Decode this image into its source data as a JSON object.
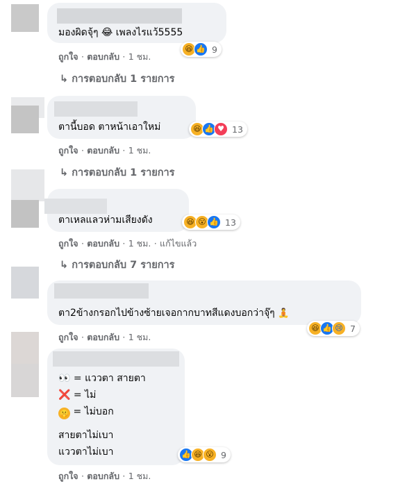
{
  "comments": [
    {
      "text": "มองผิดจุ้ๆ 😂 เพลงไรแว้5555",
      "reaction_count": "9",
      "actions": {
        "like": "ถูกใจ",
        "reply": "ตอบกลับ",
        "time": "1 ชม."
      },
      "replies": "การตอบกลับ 1 รายการ"
    },
    {
      "text": "ตานี้บอด ตาหน้าเอาใหม่",
      "reaction_count": "13",
      "actions": {
        "like": "ถูกใจ",
        "reply": "ตอบกลับ",
        "time": "1 ชม."
      },
      "replies": "การตอบกลับ 1 รายการ"
    },
    {
      "text": "ตาเหลแลวห่ามเสียงดัง",
      "reaction_count": "13",
      "actions": {
        "like": "ถูกใจ",
        "reply": "ตอบกลับ",
        "time": "1 ชม.",
        "edited": "แก้ไขแล้ว"
      },
      "replies": "การตอบกลับ 7 รายการ"
    },
    {
      "text": "ตา2ข้างกรอกไปข้างซ้ายเจอกากบาทสีแดงบอกว่าจุ๊ๆ",
      "reaction_count": "7",
      "actions": {
        "like": "ถูกใจ",
        "reply": "ตอบกลับ",
        "time": "1 ชม."
      }
    },
    {
      "lines": {
        "eyes": "👀 = แววตา สายตา",
        "cross": "❌ = ไม่",
        "shush": "= ไม่บอก",
        "p1": "สายตาไม่เบา",
        "p2": "แววตาไม่เบา"
      },
      "reaction_count": "9",
      "actions": {
        "like": "ถูกใจ",
        "reply": "ตอบกลับ",
        "time": "1 ชม."
      }
    }
  ],
  "separator": "·",
  "reply_arrow": "↳",
  "icons": [
    "haha-reaction-icon",
    "like-reaction-icon",
    "love-reaction-icon",
    "wow-reaction-icon",
    "sad-reaction-icon",
    "reply-arrow-icon",
    "meditating-person-emoji",
    "shushing-face-emoji"
  ],
  "colors": {
    "bubble": "#f0f2f5",
    "meta": "#65676b",
    "like": "#1877f2",
    "haha": "#f7b125",
    "love": "#f33e58"
  }
}
